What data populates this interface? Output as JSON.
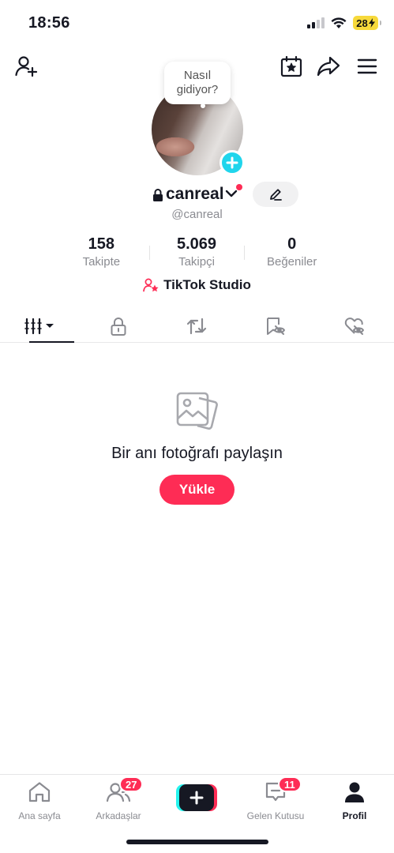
{
  "status_bar": {
    "time": "18:56",
    "battery": "28"
  },
  "bubble": {
    "text": "Nasıl gidiyor?"
  },
  "profile": {
    "username": "canreal",
    "handle": "@canreal",
    "studio_label": "TikTok Studio"
  },
  "stats": [
    {
      "value": "158",
      "label": "Takipte"
    },
    {
      "value": "5.069",
      "label": "Takipçi"
    },
    {
      "value": "0",
      "label": "Beğeniler"
    }
  ],
  "empty_state": {
    "title": "Bir anı fotoğrafı paylaşın",
    "button": "Yükle"
  },
  "bottom_nav": {
    "home": "Ana sayfa",
    "friends": "Arkadaşlar",
    "friends_badge": "27",
    "inbox": "Gelen Kutusu",
    "inbox_badge": "11",
    "profile": "Profil"
  },
  "colors": {
    "accent": "#fe2c55",
    "cyan": "#20d5ec",
    "text": "#161823",
    "muted": "#8a8b91"
  }
}
